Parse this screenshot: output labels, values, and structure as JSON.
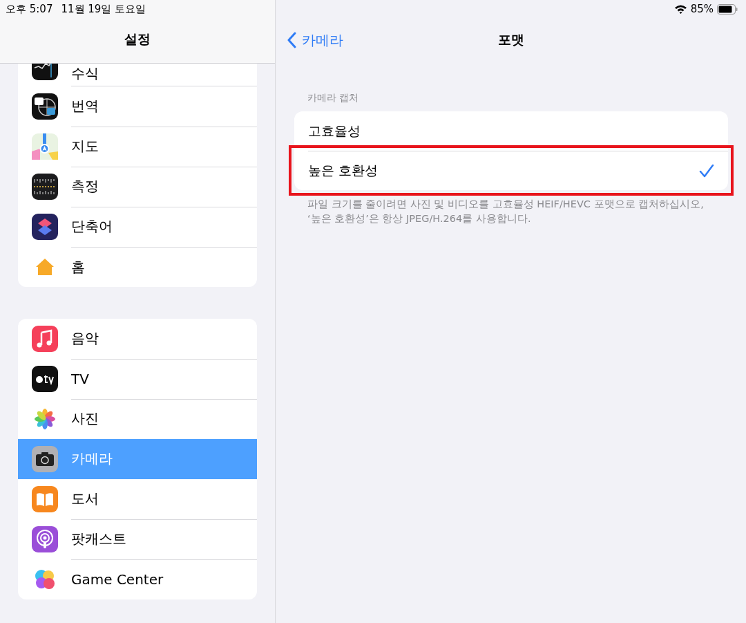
{
  "status_bar": {
    "time": "오후 5:07",
    "date": "11월 19일 토요일",
    "battery": "85%"
  },
  "sidebar": {
    "title": "설정",
    "groups": [
      {
        "items": [
          {
            "label": "수식",
            "kind": "stocks",
            "selected": false
          },
          {
            "label": "번역",
            "kind": "translate",
            "selected": false
          },
          {
            "label": "지도",
            "kind": "maps",
            "selected": false
          },
          {
            "label": "측정",
            "kind": "measure",
            "selected": false
          },
          {
            "label": "단축어",
            "kind": "shortcuts",
            "selected": false
          },
          {
            "label": "홈",
            "kind": "home",
            "selected": false
          }
        ]
      },
      {
        "items": [
          {
            "label": "음악",
            "kind": "music",
            "selected": false
          },
          {
            "label": "TV",
            "kind": "tv",
            "selected": false
          },
          {
            "label": "사진",
            "kind": "photos",
            "selected": false
          },
          {
            "label": "카메라",
            "kind": "camera",
            "selected": true
          },
          {
            "label": "도서",
            "kind": "books",
            "selected": false
          },
          {
            "label": "팟캐스트",
            "kind": "podcasts",
            "selected": false
          },
          {
            "label": "Game Center",
            "kind": "gamecenter",
            "selected": false
          }
        ]
      }
    ]
  },
  "detail": {
    "back": "카메라",
    "title": "포맷",
    "section": {
      "header": "카메라 캡처",
      "options": [
        {
          "label": "고효율성",
          "checked": false,
          "highlighted": false
        },
        {
          "label": "높은 호환성",
          "checked": true,
          "highlighted": true
        }
      ],
      "footer": "파일 크기를 줄이려면 사진 및 비디오를 고효율성 HEIF/HEVC 포맷으로 캡처하십시오, ‘높은 호환성’은 항상 JPEG/H.264를 사용합니다."
    }
  }
}
